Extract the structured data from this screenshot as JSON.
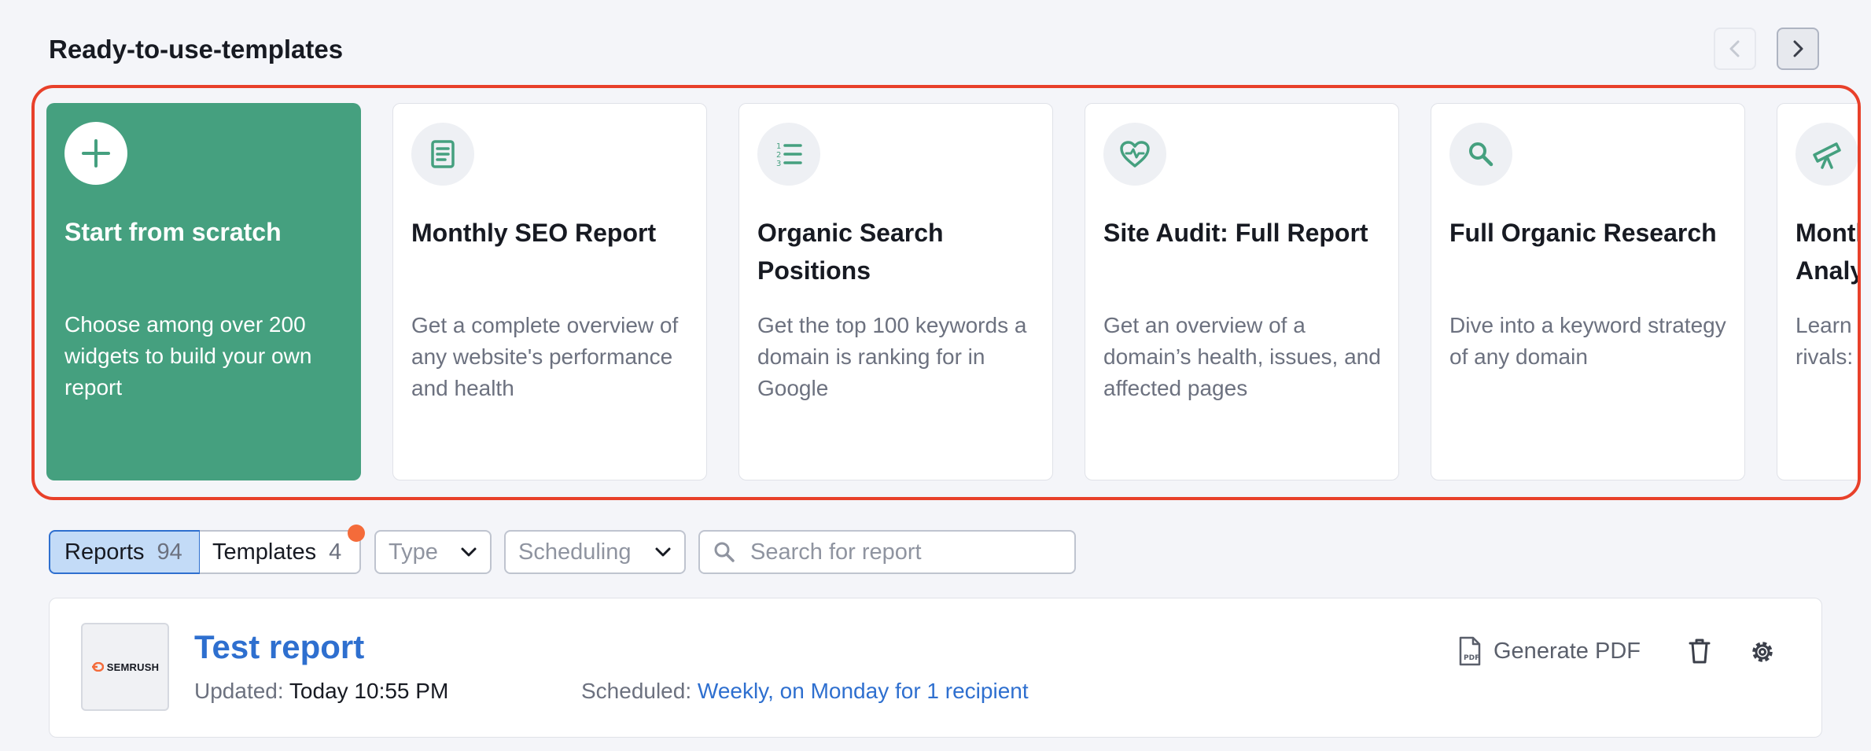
{
  "section": {
    "title": "Ready-to-use-templates"
  },
  "templates": [
    {
      "icon": "plus-icon",
      "title": "Start from scratch",
      "description": "Choose among over 200 widgets to build your own report"
    },
    {
      "icon": "document-icon",
      "title": "Monthly SEO Report",
      "description": "Get a complete overview of any website's performance and health"
    },
    {
      "icon": "numbered-list-icon",
      "title": "Organic Search Positions",
      "description": "Get the top 100 keywords a domain is ranking for in Google"
    },
    {
      "icon": "heart-pulse-icon",
      "title": "Site Audit: Full Report",
      "description": "Get an overview of a domain’s health, issues, and affected pages"
    },
    {
      "icon": "search-icon",
      "title": "Full Organic Research",
      "description": "Dive into a keyword strategy of any domain"
    },
    {
      "icon": "telescope-icon",
      "title": "Monthly Competitor Analysis",
      "description": "Learn more about your rivals: their traffic, content"
    }
  ],
  "filters": {
    "reports_label": "Reports",
    "reports_count": "94",
    "templates_label": "Templates",
    "templates_count": "4",
    "type_label": "Type",
    "scheduling_label": "Scheduling",
    "search_placeholder": "Search for report"
  },
  "report": {
    "logo_text": "SEMRUSH",
    "title": "Test report",
    "updated_label": "Updated:",
    "updated_value": "Today 10:55 PM",
    "scheduled_label": "Scheduled:",
    "scheduled_value": "Weekly, on Monday for 1 recipient",
    "generate_pdf_label": "Generate PDF",
    "pdf_badge": "PDF"
  },
  "colors": {
    "accent_green": "#45a07f",
    "link_blue": "#2e6fcf",
    "highlight_red": "#e8402a",
    "notification_orange": "#f46b3a"
  }
}
